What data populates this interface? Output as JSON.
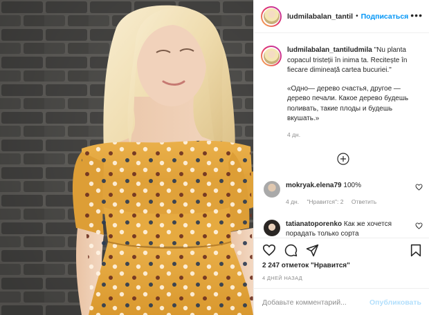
{
  "post": {
    "username": "ludmilabalan_tantil",
    "follow_label": "Подписаться",
    "more_label": "•••",
    "photo_alt": "Photo"
  },
  "caption": {
    "username": "ludmilabalan_tantiludmila",
    "text_ro": "\"Nu planta copacul tristeții în inima ta. Recitește în fiecare dimineață cartea bucuriei.\"",
    "text_ru": "«Одно— дерево счастья, другое — дерево печали. Какое дерево будешь поливать, такие плоды и будешь вкушать.»",
    "time": "4 дн."
  },
  "comments": [
    {
      "username": "mokryak.elena79",
      "text": "100%",
      "time": "4 дн.",
      "likes": "\"Нравится\": 2",
      "reply": "Ответить"
    },
    {
      "username": "tatianatoporenko",
      "text": "Как же хочется порадать только сорта"
    }
  ],
  "actions": {
    "likes": "2 247 отметок \"Нравится\"",
    "date": "4 ДНЕЙ НАЗАД",
    "comment_placeholder": "Добавьте комментарий...",
    "publish_label": "Опубликовать"
  },
  "colors": {
    "accent": "#0095f6",
    "publish_disabled": "#b2dffc",
    "dress": "#e2a63a",
    "text_secondary": "#8e8e8e"
  },
  "icons": [
    "more-icon",
    "plus-circle-icon",
    "heart-icon",
    "comment-icon",
    "share-icon",
    "bookmark-icon"
  ]
}
